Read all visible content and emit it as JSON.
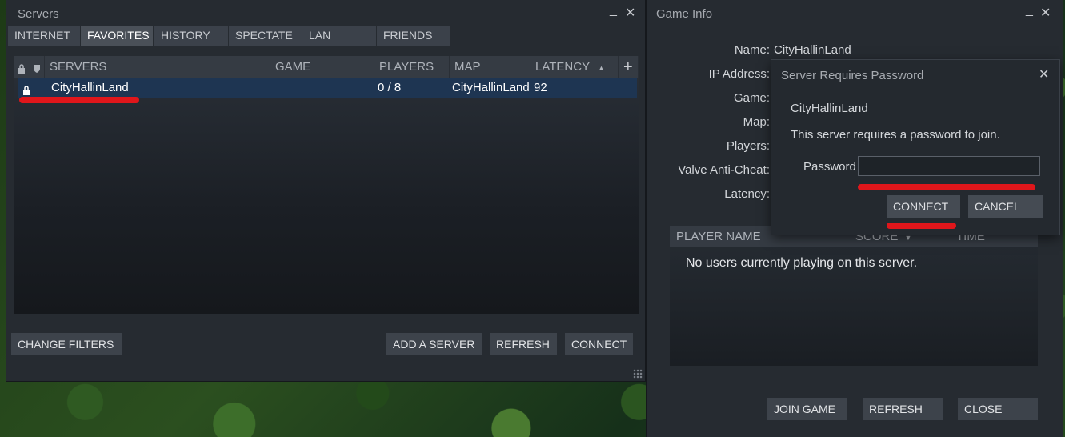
{
  "servers_window": {
    "title": "Servers",
    "minimize": "_",
    "close": "✕",
    "tabs": [
      "INTERNET",
      "FAVORITES",
      "HISTORY",
      "SPECTATE",
      "LAN",
      "FRIENDS"
    ],
    "active_tab": "FAVORITES",
    "columns": {
      "servers": "SERVERS",
      "game": "GAME",
      "players": "PLAYERS",
      "map": "MAP",
      "latency": "LATENCY",
      "add": "+"
    },
    "rows": [
      {
        "name": "CityHallinLand",
        "game": "",
        "players": "0 / 8",
        "map": "CityHallinLand",
        "latency": "92"
      }
    ],
    "buttons": {
      "change_filters": "CHANGE FILTERS",
      "add_server": "ADD A SERVER",
      "refresh": "REFRESH",
      "connect": "CONNECT"
    }
  },
  "game_info_window": {
    "title": "Game Info",
    "minimize": "_",
    "close": "✕",
    "labels": {
      "name": "Name:",
      "ip": "IP Address:",
      "game": "Game:",
      "map": "Map:",
      "players": "Players:",
      "vac": "Valve Anti-Cheat:",
      "latency": "Latency:"
    },
    "name_value": "CityHallinLand",
    "player_columns": {
      "name": "PLAYER NAME",
      "score": "SCORE",
      "time": "TIME"
    },
    "empty_message": "No users currently playing on this server.",
    "buttons": {
      "join": "JOIN GAME",
      "refresh": "REFRESH",
      "close": "CLOSE"
    }
  },
  "password_dialog": {
    "title": "Server Requires Password",
    "close": "✕",
    "server_name": "CityHallinLand",
    "message": "This server requires a password to join.",
    "password_label": "Password",
    "password_value": "",
    "buttons": {
      "connect": "CONNECT",
      "cancel": "CANCEL"
    }
  },
  "colors": {
    "accent": "#1e3552",
    "annotation_red": "#e0161b"
  }
}
